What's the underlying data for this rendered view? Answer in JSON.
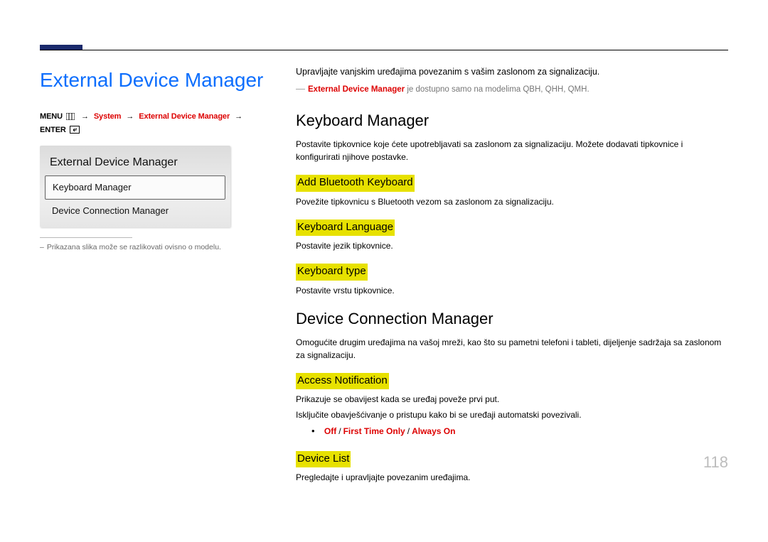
{
  "page_number": "118",
  "left": {
    "title": "External Device Manager",
    "breadcrumb": {
      "label_menu": "MENU",
      "label_system": "System",
      "label_edm": "External Device Manager",
      "label_enter": "ENTER"
    },
    "osd": {
      "title": "External Device Manager",
      "items": [
        {
          "label": "Keyboard Manager",
          "selected": true
        },
        {
          "label": "Device Connection Manager",
          "selected": false
        }
      ]
    },
    "note": "Prikazana slika može se razlikovati ovisno o modelu."
  },
  "right": {
    "intro": "Upravljajte vanjskim uređajima povezanim s vašim zaslonom za signalizaciju.",
    "info": {
      "feature": "External Device Manager",
      "rest": " je dostupno samo na modelima QBH, QHH, QMH."
    },
    "sections": [
      {
        "heading": "Keyboard Manager",
        "desc": "Postavite tipkovnice koje ćete upotrebljavati sa zaslonom za signalizaciju. Možete dodavati tipkovnice i konfigurirati njihove postavke.",
        "subs": [
          {
            "title": "Add Bluetooth Keyboard",
            "desc": "Povežite tipkovnicu s Bluetooth vezom sa zaslonom za signalizaciju."
          },
          {
            "title": "Keyboard Language",
            "desc": "Postavite jezik tipkovnice."
          },
          {
            "title": "Keyboard type",
            "desc": "Postavite vrstu tipkovnice."
          }
        ]
      },
      {
        "heading": "Device Connection Manager",
        "desc": " Omogućite drugim uređajima na vašoj mreži, kao što su pametni telefoni i tableti, dijeljenje sadržaja sa zaslonom za signalizaciju.",
        "subs": [
          {
            "title": "Access Notification",
            "desc": "Prikazuje se obavijest kada se uređaj poveže prvi put.",
            "desc2": "Isključite obavješćivanje o pristupu kako bi se uređaji automatski povezivali.",
            "options": [
              "Off",
              "First Time Only",
              "Always On"
            ]
          },
          {
            "title": "Device List",
            "desc": "Pregledajte i upravljajte povezanim uređajima."
          }
        ]
      }
    ]
  }
}
